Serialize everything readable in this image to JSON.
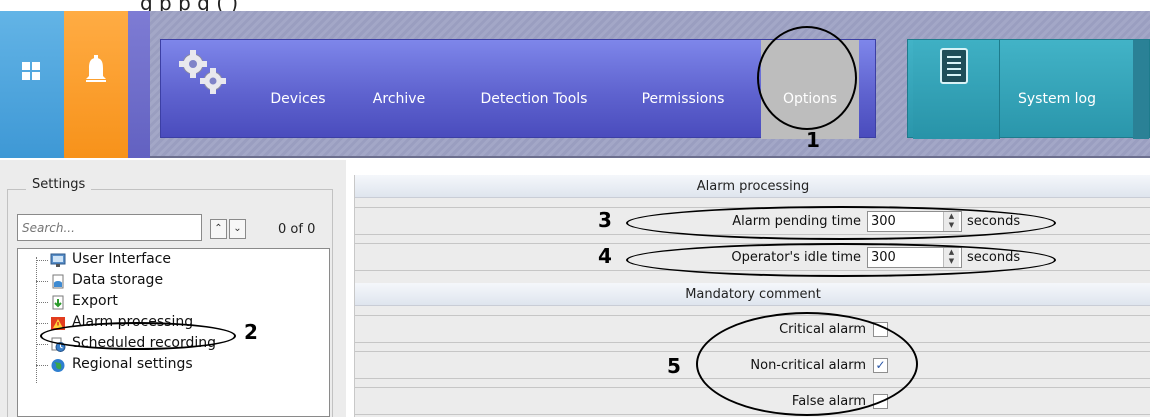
{
  "caption": "g   p                                    p       g (   )",
  "topbar": {
    "nav_items": [
      "Devices",
      "Archive",
      "Detection Tools",
      "Permissions",
      "Options"
    ],
    "active_item": "Options",
    "system_log_label": "System log",
    "colors": {
      "windows_tile": "#4aa7e0",
      "alarm_tile": "#f7921a",
      "nav": "#5f63cf",
      "system_log": "#2a96ab"
    }
  },
  "settings_panel": {
    "group_label": "Settings",
    "search_placeholder": "Search...",
    "result_count": "0 of 0",
    "tree_items": [
      {
        "label": "User Interface",
        "icon": "monitor-icon"
      },
      {
        "label": "Data storage",
        "icon": "database-icon"
      },
      {
        "label": "Export",
        "icon": "export-icon"
      },
      {
        "label": "Alarm processing",
        "icon": "alarm-icon",
        "selected": true
      },
      {
        "label": "Scheduled recording",
        "icon": "clock-icon"
      },
      {
        "label": "Regional settings",
        "icon": "globe-icon"
      }
    ]
  },
  "alarm_panel": {
    "section1_title": "Alarm processing",
    "alarm_pending_label": "Alarm pending time",
    "alarm_pending_value": "300",
    "operator_idle_label": "Operator's idle time",
    "operator_idle_value": "300",
    "unit": "seconds",
    "section2_title": "Mandatory comment",
    "critical_label": "Critical alarm",
    "critical_checked": false,
    "noncritical_label": "Non-critical alarm",
    "noncritical_checked": true,
    "false_label": "False alarm",
    "false_checked": false
  },
  "annotations": {
    "n1": "1",
    "n2": "2",
    "n3": "3",
    "n4": "4",
    "n5": "5"
  }
}
